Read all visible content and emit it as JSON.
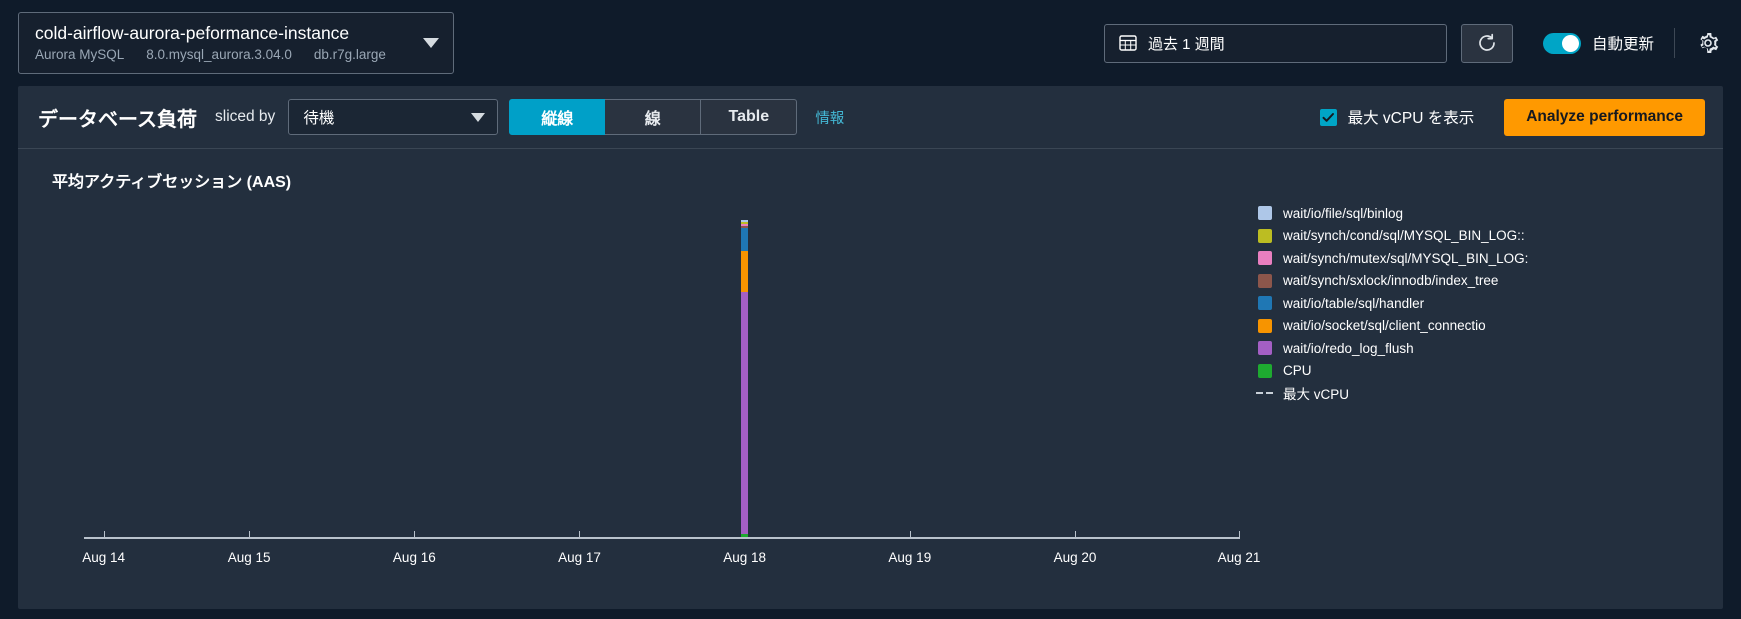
{
  "header": {
    "instance": {
      "name": "cold-airflow-aurora-peformance-instance",
      "engine": "Aurora MySQL",
      "version": "8.0.mysql_aurora.3.04.0",
      "size": "db.r7g.large"
    },
    "time_range": "過去 1 週間",
    "calendar_icon": "calendar-icon",
    "refresh_icon": "refresh-icon",
    "auto_refresh_label": "自動更新",
    "auto_refresh_on": true,
    "settings_icon": "gear-icon"
  },
  "controls": {
    "title": "データベース負荷",
    "sliced_by_label": "sliced by",
    "slice_value": "待機",
    "view_modes": [
      {
        "label": "縦線",
        "active": true
      },
      {
        "label": "線",
        "active": false
      },
      {
        "label": "Table",
        "active": false
      }
    ],
    "info_link": "情報",
    "max_vcpu_checkbox_label": "最大 vCPU を表示",
    "max_vcpu_checked": true,
    "analyze_button": "Analyze performance",
    "accent_color": "#00a0c8",
    "button_color": "#ff9900"
  },
  "chart_data": {
    "type": "bar",
    "title": "平均アクティブセッション (AAS)",
    "xlabel": "",
    "ylabel": "",
    "stacked": true,
    "grid": false,
    "legend_position": "right",
    "categories": [
      "Aug 14",
      "Aug 15",
      "Aug 16",
      "Aug 17",
      "Aug 18",
      "Aug 19",
      "Aug 20",
      "Aug 21"
    ],
    "x_tick_labels": [
      "Aug 14",
      "Aug 15",
      "Aug 16",
      "Aug 17",
      "Aug 18",
      "Aug 19",
      "Aug 20",
      "Aug 21"
    ],
    "x_tick_positions_pct": [
      1.7,
      14.3,
      28.6,
      42.9,
      57.2,
      71.5,
      85.8,
      100.0
    ],
    "series": [
      {
        "name": "CPU",
        "color": "#1eaa30",
        "values": [
          0,
          0,
          0,
          0,
          0.01,
          0,
          0,
          0
        ]
      },
      {
        "name": "wait/io/redo_log_flush",
        "color": "#a45fc4",
        "values": [
          0,
          0,
          0,
          0,
          0.7,
          0,
          0,
          0
        ]
      },
      {
        "name": "wait/io/socket/sql/client_connectio",
        "color": "#f79400",
        "values": [
          0,
          0,
          0,
          0,
          0.12,
          0,
          0,
          0
        ]
      },
      {
        "name": "wait/io/table/sql/handler",
        "color": "#1f77b4",
        "values": [
          0,
          0,
          0,
          0,
          0.065,
          0,
          0,
          0
        ]
      },
      {
        "name": "wait/synch/sxlock/innodb/index_tree",
        "color": "#8c564b",
        "values": [
          0,
          0,
          0,
          0,
          0.008,
          0,
          0,
          0
        ]
      },
      {
        "name": "wait/synch/mutex/sql/MYSQL_BIN_LOG:",
        "color": "#e97fc0",
        "values": [
          0,
          0,
          0,
          0,
          0.005,
          0,
          0,
          0
        ]
      },
      {
        "name": "wait/synch/cond/sql/MYSQL_BIN_LOG::",
        "color": "#bcbd22",
        "values": [
          0,
          0,
          0,
          0,
          0.005,
          0,
          0,
          0
        ]
      },
      {
        "name": "wait/io/file/sql/binlog",
        "color": "#aec7e8",
        "values": [
          0,
          0,
          0,
          0,
          0.005,
          0,
          0,
          0
        ]
      }
    ],
    "bar_x_pct": 57.2,
    "legend": [
      {
        "label": "wait/io/file/sql/binlog",
        "color": "#aec7e8",
        "style": "swatch"
      },
      {
        "label": "wait/synch/cond/sql/MYSQL_BIN_LOG::",
        "color": "#bcbd22",
        "style": "swatch"
      },
      {
        "label": "wait/synch/mutex/sql/MYSQL_BIN_LOG:",
        "color": "#e97fc0",
        "style": "swatch"
      },
      {
        "label": "wait/synch/sxlock/innodb/index_tree",
        "color": "#8c564b",
        "style": "swatch"
      },
      {
        "label": "wait/io/table/sql/handler",
        "color": "#1f77b4",
        "style": "swatch"
      },
      {
        "label": "wait/io/socket/sql/client_connectio",
        "color": "#f79400",
        "style": "swatch"
      },
      {
        "label": "wait/io/redo_log_flush",
        "color": "#a45fc4",
        "style": "swatch"
      },
      {
        "label": "CPU",
        "color": "#1eaa30",
        "style": "swatch"
      },
      {
        "label": "最大 vCPU",
        "color": "#c8d0d8",
        "style": "dashed-line"
      }
    ]
  }
}
